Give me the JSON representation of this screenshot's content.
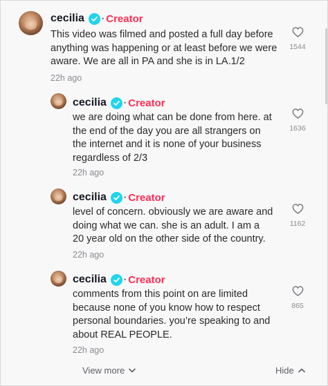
{
  "comments": [
    {
      "username": "cecilia",
      "badge": "Creator",
      "text": "This video was filmed and posted a full day before anything was happening or at least before we were aware. We are all in PA and she is in LA.1/2",
      "time": "22h ago",
      "likes": "1544"
    },
    {
      "username": "cecilia",
      "badge": "Creator",
      "text": "we are doing what can be done from here. at the end of the day you are all strangers on the internet and it is none of your business regardless of 2/3",
      "time": "22h ago",
      "likes": "1636"
    },
    {
      "username": "cecilia",
      "badge": "Creator",
      "text": "level of concern. obviously we are aware and doing what we can. she is an adult. I am a 20 year old on the other side of the country.",
      "time": "22h ago",
      "likes": "1162"
    },
    {
      "username": "cecilia",
      "badge": "Creator",
      "text": "comments from this point on are limited because none of you know how to respect personal boundaries. you’re speaking to and about REAL PEOPLE.",
      "time": "22h ago",
      "likes": "865"
    }
  ],
  "footer": {
    "view_more": "View more",
    "hide": "Hide"
  },
  "icons": {
    "verified": "verified-check-icon",
    "like": "heart-outline-icon",
    "view_more": "chevron-down-icon",
    "hide": "chevron-up-icon"
  },
  "colors": {
    "creator": "#fe2c55",
    "verified": "#20d5ec",
    "muted": "#8a8b91"
  }
}
